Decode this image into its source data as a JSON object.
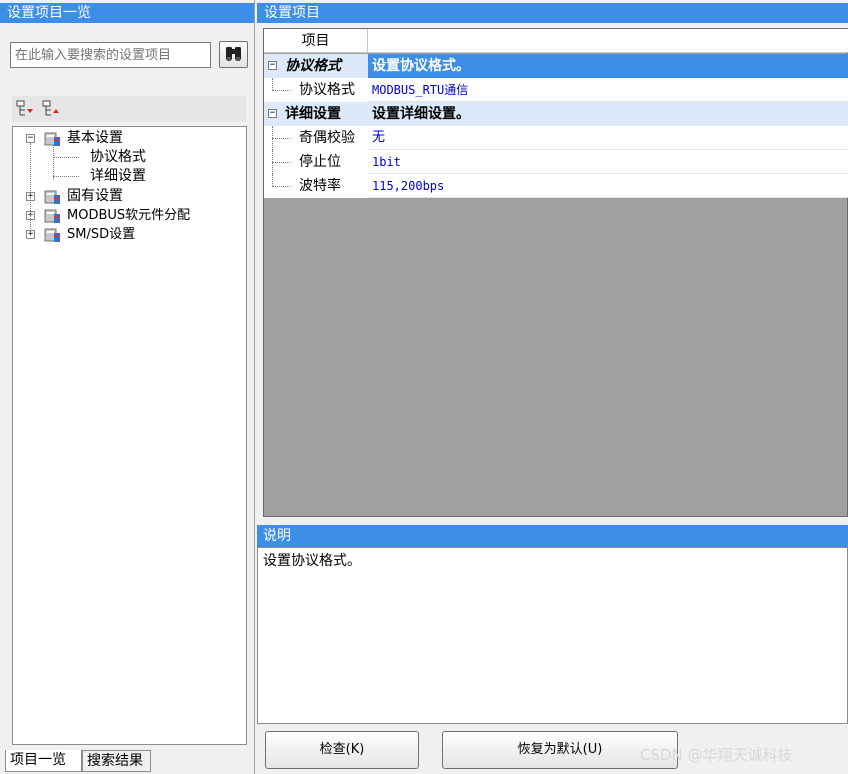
{
  "left_pane": {
    "title": "设置项目一览",
    "search_placeholder": "在此输入要搜索的设置项目",
    "tree": {
      "basic": "基本设置",
      "basic_children": [
        "协议格式",
        "详细设置"
      ],
      "inherent": "固有设置",
      "modbus": "MODBUS软元件分配",
      "smsd": "SM/SD设置"
    },
    "tabs": {
      "list": "项目一览",
      "results": "搜索结果"
    }
  },
  "right_pane": {
    "title": "设置项目",
    "grid_header": "项目",
    "sections": [
      {
        "name": "协议格式",
        "value": "设置协议格式。",
        "items": [
          {
            "name": "协议格式",
            "value": "MODBUS_RTU通信"
          }
        ]
      },
      {
        "name": "详细设置",
        "value": "设置详细设置。",
        "items": [
          {
            "name": "奇偶校验",
            "value": "无"
          },
          {
            "name": "停止位",
            "value": "1bit"
          },
          {
            "name": "波特率",
            "value": "115,200bps"
          }
        ]
      }
    ],
    "description_title": "说明",
    "description_text": "设置协议格式。"
  },
  "buttons": {
    "check": "检查(K)",
    "reset": "恢复为默认(U)"
  },
  "watermark": "CSDN @华翔天诚科技",
  "colors": {
    "header_blue": "#3d8ee8",
    "section_fill": "#dbe9f9",
    "value_blue": "#0000cc",
    "grid_empty": "#a0a0a0"
  }
}
